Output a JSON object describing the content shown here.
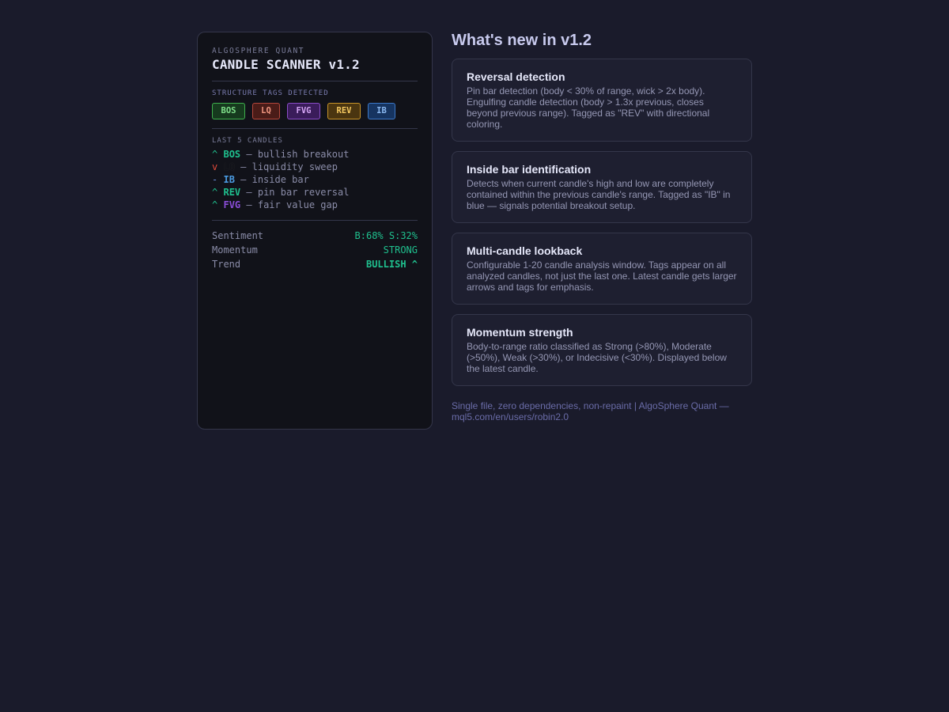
{
  "panel": {
    "brand": "ALGOSPHERE QUANT",
    "title": "CANDLE SCANNER v1.2",
    "tags_label": "STRUCTURE TAGS DETECTED",
    "tags": [
      "BOS",
      "LQ",
      "FVG",
      "REV",
      "IB"
    ],
    "candles_label": "LAST 5 CANDLES",
    "candles": [
      {
        "arrow": "^",
        "tag": "BOS",
        "desc": " — bullish breakout"
      },
      {
        "arrow": "v",
        "tag": "LQ",
        "desc": " — liquidity sweep"
      },
      {
        "arrow": "-",
        "tag": "IB",
        "desc": " — inside bar"
      },
      {
        "arrow": "^",
        "tag": "REV",
        "desc": " — pin bar reversal"
      },
      {
        "arrow": "^",
        "tag": "FVG",
        "desc": " — fair value gap"
      }
    ],
    "stats": [
      {
        "label": "Sentiment",
        "value": "B:68% S:32%"
      },
      {
        "label": "Momentum",
        "value": "STRONG"
      },
      {
        "label": "Trend",
        "value": "BULLISH ^"
      }
    ]
  },
  "whats_new": {
    "heading": "What's new in v1.2",
    "cards": [
      {
        "title": "Reversal detection",
        "desc": "Pin bar detection (body < 30% of range, wick > 2x body). Engulfing candle detection (body > 1.3x previous, closes beyond previous range). Tagged as \"REV\" with directional coloring."
      },
      {
        "title": "Inside bar identification",
        "desc": "Detects when current candle's high and low are completely contained within the previous candle's range. Tagged as \"IB\" in blue — signals potential breakout setup."
      },
      {
        "title": "Multi-candle lookback",
        "desc": "Configurable 1-20 candle analysis window. Tags appear on all analyzed candles, not just the last one. Latest candle gets larger arrows and tags for emphasis."
      },
      {
        "title": "Momentum strength",
        "desc": "Body-to-range ratio classified as Strong (>80%), Moderate (>50%), Weak (>30%), or Indecisive (<30%). Displayed below the latest candle."
      }
    ],
    "footer": "Single file, zero dependencies, non-repaint | AlgoSphere Quant — mql5.com/en/users/robin2.0"
  }
}
